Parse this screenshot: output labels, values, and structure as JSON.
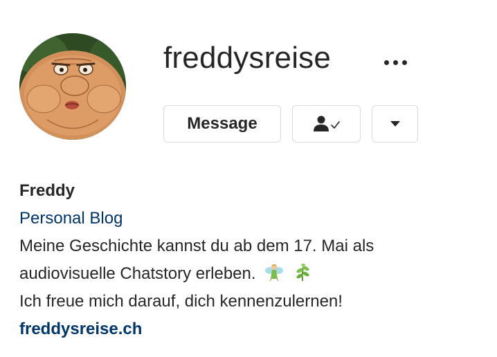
{
  "profile": {
    "username": "freddysreise",
    "avatar_alt": "profile-avatar",
    "more_icon": "more-horizontal-icon"
  },
  "actions": {
    "message_label": "Message",
    "following_icon": "person-check-icon",
    "dropdown_icon": "caret-down-icon"
  },
  "bio": {
    "name": "Freddy",
    "category": "Personal Blog",
    "line1": "Meine Geschichte kannst du ab dem 17. Mai als",
    "line2": "audiovisuelle Chatstory erleben.",
    "line2_emojis": [
      "fairy-emoji",
      "herb-emoji"
    ],
    "line3": "Ich freue mich darauf, dich kennenzulernen!",
    "website": "freddysreise.ch"
  },
  "colors": {
    "text": "#262626",
    "link": "#00376b",
    "category": "#003569",
    "border": "#dbdbdb"
  }
}
